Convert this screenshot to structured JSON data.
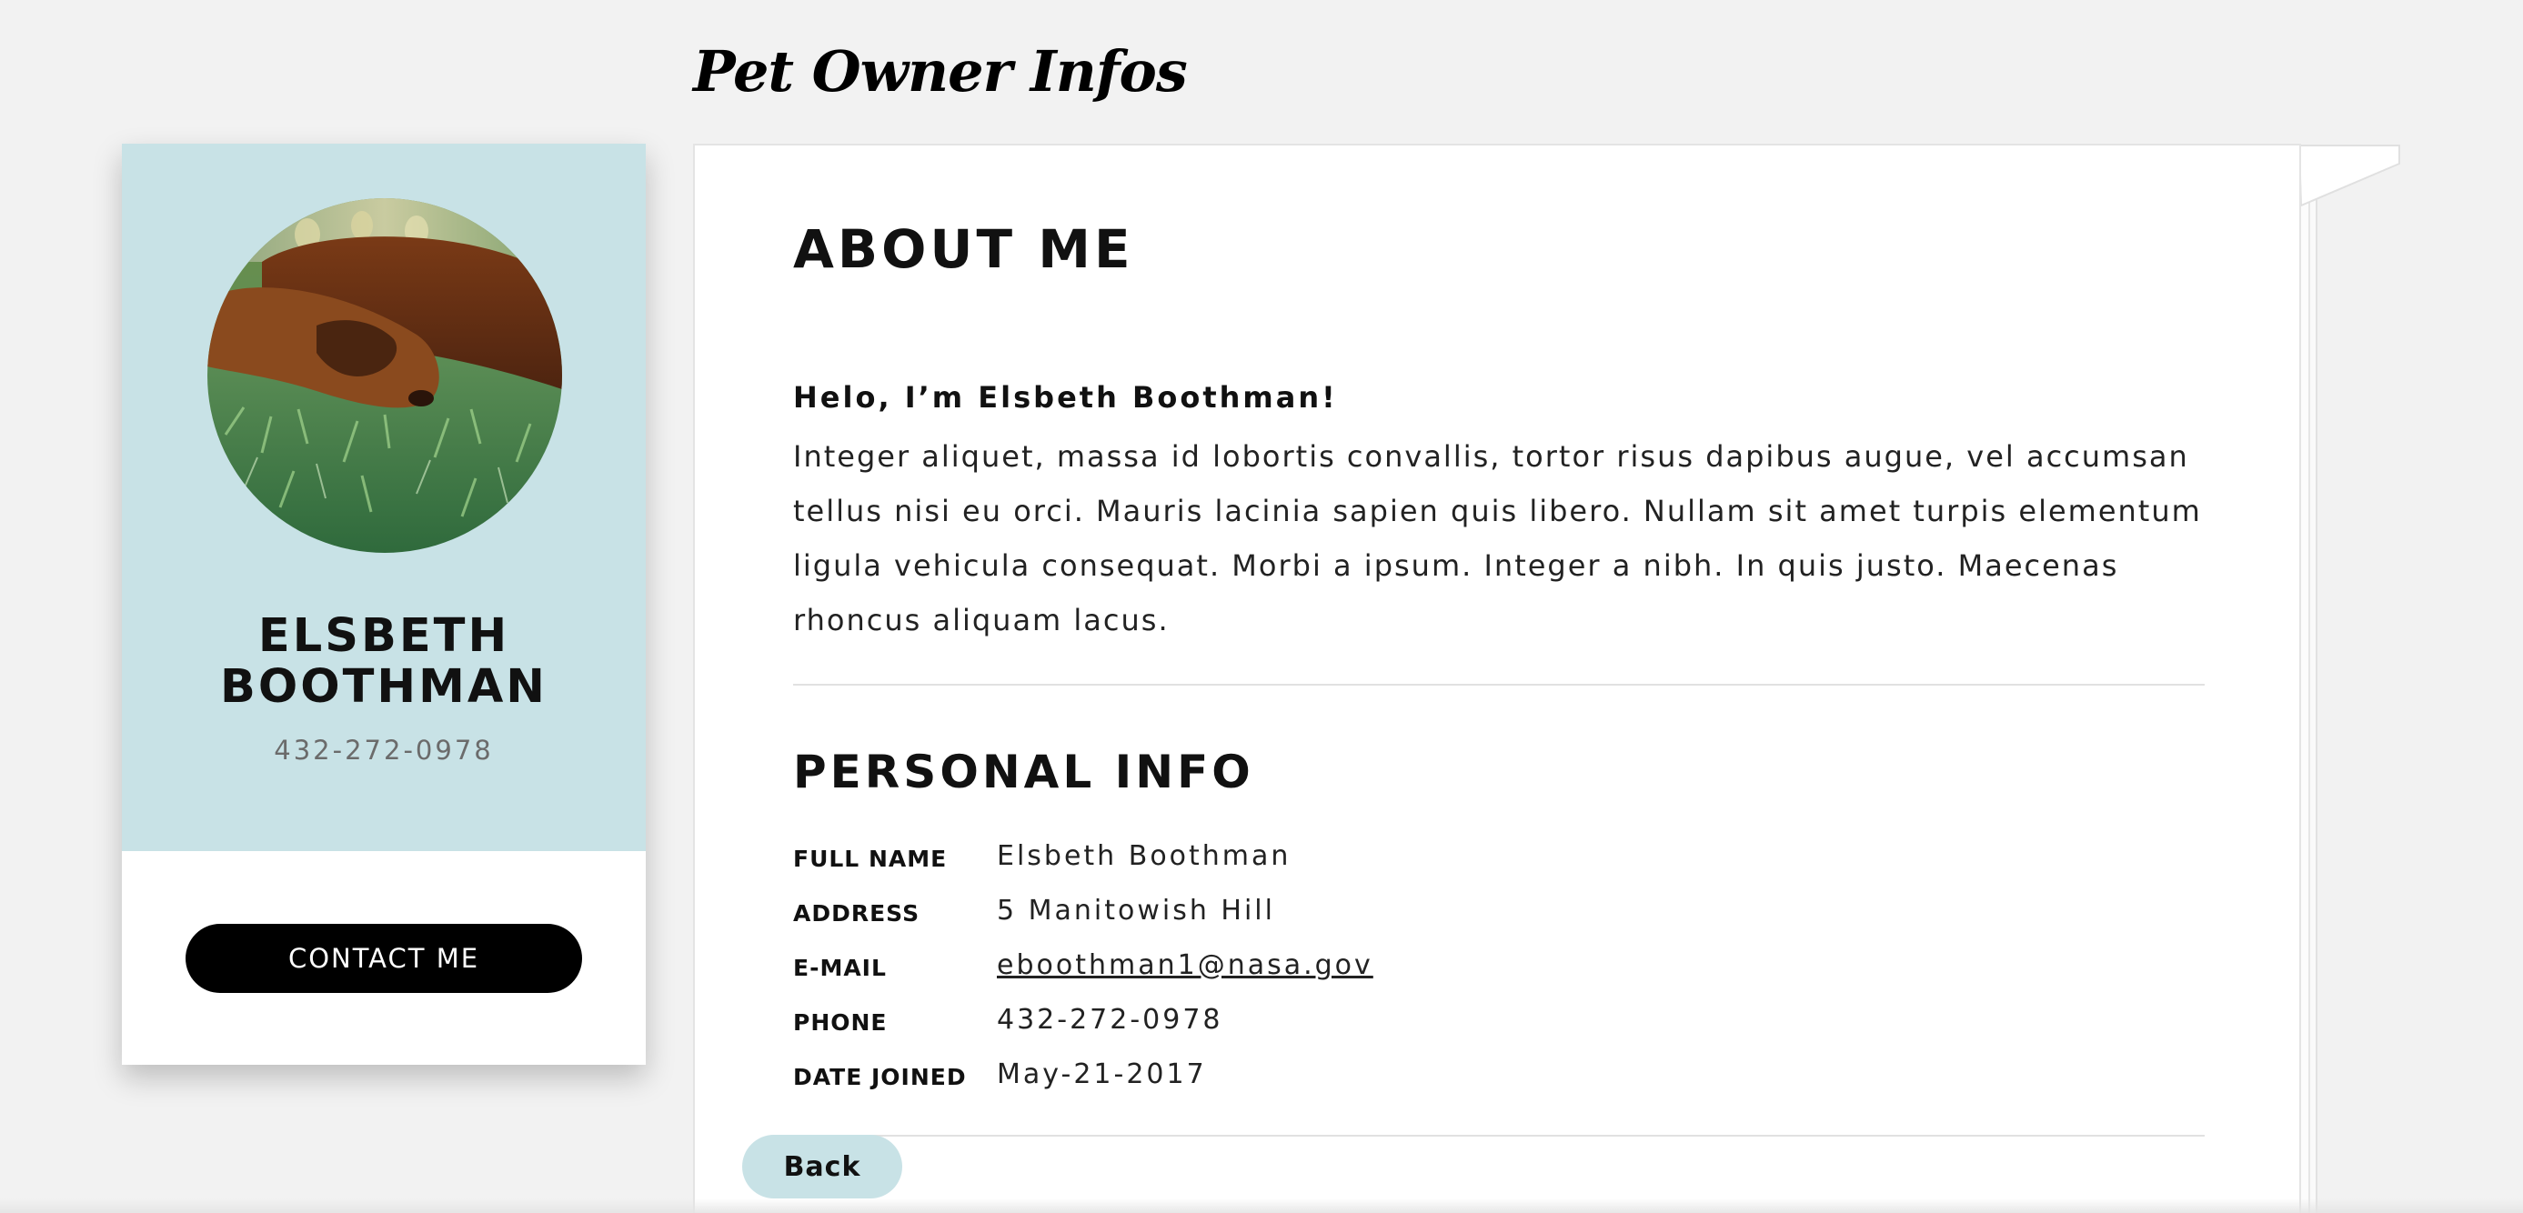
{
  "page": {
    "title": "Pet Owner Infos"
  },
  "profile": {
    "name": "ELSBETH BOOTHMAN",
    "phone": "432-272-0978",
    "contact_label": "CONTACT ME",
    "avatar_icon": "dog-photo"
  },
  "about": {
    "title": "ABOUT ME",
    "greeting": "Helo, I’m Elsbeth Boothman!",
    "bio": "Integer aliquet, massa id lobortis convallis, tortor risus dapibus augue, vel accumsan tellus nisi eu orci. Mauris lacinia sapien quis libero. Nullam sit amet turpis elementum ligula vehicula consequat. Morbi a ipsum. Integer a nibh. In quis justo. Maecenas rhoncus aliquam lacus."
  },
  "personal": {
    "title": "PERSONAL INFO",
    "rows": [
      {
        "label": "FULL NAME",
        "value": "Elsbeth Boothman"
      },
      {
        "label": "ADDRESS",
        "value": "5 Manitowish Hill"
      },
      {
        "label": "E-MAIL",
        "value": "eboothman1@nasa.gov"
      },
      {
        "label": "PHONE",
        "value": "432-272-0978"
      },
      {
        "label": "DATE JOINED",
        "value": "May-21-2017"
      }
    ]
  },
  "nav": {
    "back_label": "Back"
  },
  "colors": {
    "background": "#f2f2f2",
    "card_accent": "#c8e2e6",
    "button_dark": "#000000"
  }
}
